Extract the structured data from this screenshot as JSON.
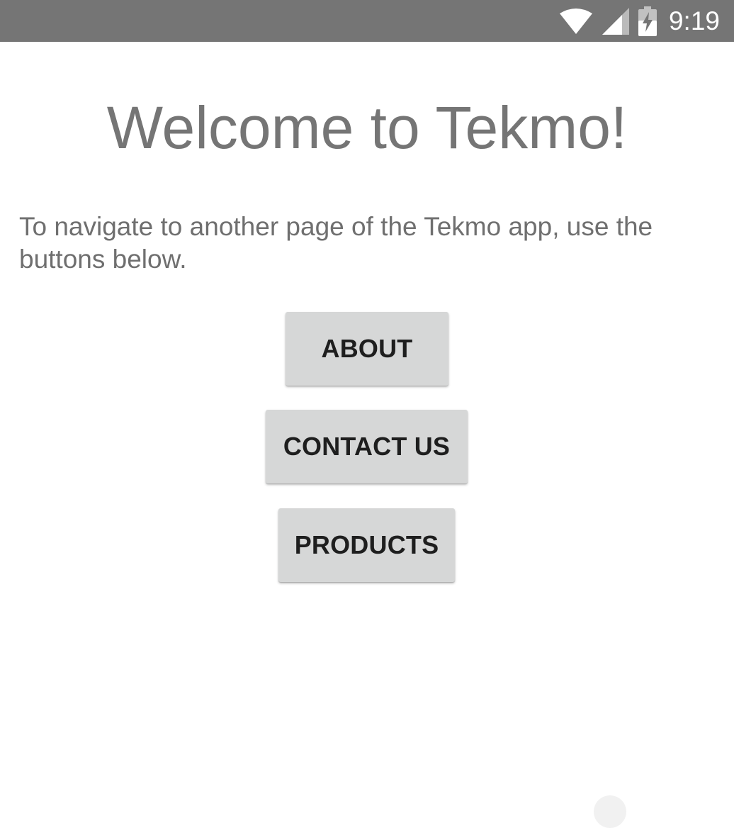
{
  "status_bar": {
    "time": "9:19",
    "icons": [
      "wifi-icon",
      "cellular-signal-icon",
      "battery-charging-icon"
    ],
    "background_color": "#757575"
  },
  "main": {
    "title": "Welcome to Tekmo!",
    "instructions": "To navigate to another page of the Tekmo app, use the buttons below.",
    "buttons": [
      {
        "label": "ABOUT"
      },
      {
        "label": "CONTACT US"
      },
      {
        "label": "PRODUCTS"
      }
    ]
  },
  "colors": {
    "title_text": "#757575",
    "body_text": "#6f6f6f",
    "button_bg": "#d6d7d7",
    "button_text": "#1e1e1e"
  }
}
